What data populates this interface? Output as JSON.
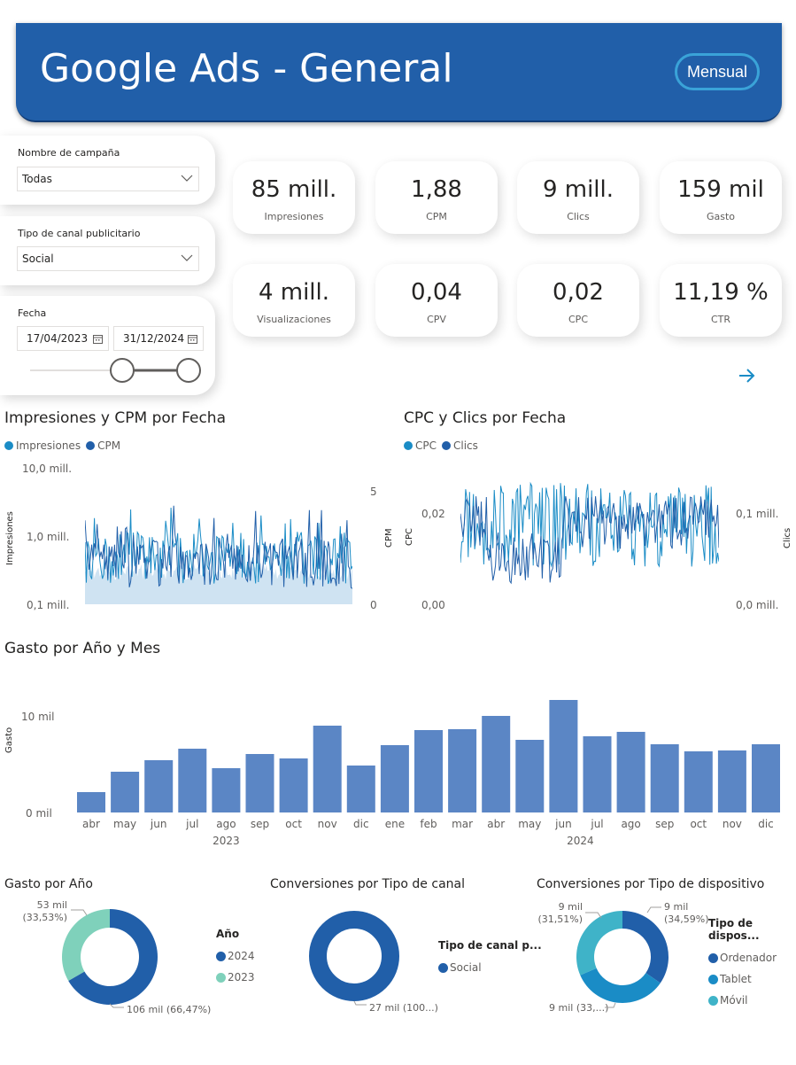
{
  "header": {
    "title": "Google Ads - General",
    "button_label": "Mensual"
  },
  "filters": {
    "campaign": {
      "label": "Nombre de campaña",
      "value": "Todas"
    },
    "channel": {
      "label": "Tipo de canal publicitario",
      "value": "Social"
    },
    "date": {
      "label": "Fecha",
      "start": "17/04/2023",
      "end": "31/12/2024"
    }
  },
  "kpis": [
    {
      "value": "85 mill.",
      "label": "Impresiones"
    },
    {
      "value": "1,88",
      "label": "CPM"
    },
    {
      "value": "9 mill.",
      "label": "Clics"
    },
    {
      "value": "159 mil",
      "label": "Gasto"
    },
    {
      "value": "4 mill.",
      "label": "Visualizaciones"
    },
    {
      "value": "0,04",
      "label": "CPV"
    },
    {
      "value": "0,02",
      "label": "CPC"
    },
    {
      "value": "11,19 %",
      "label": "CTR"
    }
  ],
  "colors": {
    "dark_blue": "#215fa9",
    "mid_blue": "#1a8cc6",
    "teal": "#3fb3c8",
    "mint": "#7fd1bb",
    "bar": "#5b86c5",
    "header": "#215fa9"
  },
  "impressions_chart": {
    "title": "Impresiones y CPM por Fecha",
    "legend": [
      "Impresiones",
      "CPM"
    ],
    "y_left_ticks": [
      "10,0 mill.",
      "1,0 mill.",
      "0,1 mill."
    ],
    "y_right_ticks": [
      "5",
      "0"
    ],
    "y_left_title": "Impresiones",
    "y_right_title": "CPM"
  },
  "cpc_chart": {
    "title": "CPC y Clics por Fecha",
    "legend": [
      "CPC",
      "Clics"
    ],
    "y_left_ticks": [
      "0,02",
      "0,00"
    ],
    "y_right_ticks": [
      "0,1 mill.",
      "0,0 mill."
    ],
    "y_left_title": "CPC",
    "y_right_title": "Clics"
  },
  "chart_data": [
    {
      "type": "bar",
      "title": "Gasto por Año y Mes",
      "ylabel": "Gasto",
      "y_ticks": [
        "10 mil",
        "0 mil"
      ],
      "ylim": [
        0,
        14000
      ],
      "categories": [
        "abr",
        "may",
        "jun",
        "jul",
        "ago",
        "sep",
        "oct",
        "nov",
        "dic",
        "ene",
        "feb",
        "mar",
        "abr",
        "may",
        "jun",
        "jul",
        "ago",
        "sep",
        "oct",
        "nov",
        "dic"
      ],
      "years": [
        {
          "label": "2023",
          "from": 0,
          "to": 8
        },
        {
          "label": "2024",
          "from": 9,
          "to": 20
        }
      ],
      "values": [
        2300,
        4600,
        5900,
        7200,
        5000,
        6600,
        6100,
        9800,
        5300,
        7600,
        9300,
        9400,
        10900,
        8200,
        12700,
        8600,
        9100,
        7700,
        6900,
        7000,
        7700
      ]
    },
    {
      "type": "pie",
      "title": "Gasto por Año",
      "legend_title": "Año",
      "slices": [
        {
          "label": "2024",
          "value": 106,
          "text": "106 mil (66,47%)"
        },
        {
          "label": "2023",
          "value": 53,
          "text": "53 mil (33,53%)"
        }
      ]
    },
    {
      "type": "pie",
      "title": "Conversiones por Tipo de canal",
      "legend_title": "Tipo de canal p...",
      "slices": [
        {
          "label": "Social",
          "value": 27,
          "text": "27 mil (100...)"
        }
      ]
    },
    {
      "type": "pie",
      "title": "Conversiones por Tipo de dispositivo",
      "legend_title": "Tipo de dispos...",
      "slices": [
        {
          "label": "Ordenador",
          "value": 34.59,
          "text": "9 mil (34,59%)"
        },
        {
          "label": "Tablet",
          "value": 33.9,
          "text": "9 mil (33,...)"
        },
        {
          "label": "Móvil",
          "value": 31.51,
          "text": "9 mil (31,51%)"
        }
      ]
    }
  ]
}
